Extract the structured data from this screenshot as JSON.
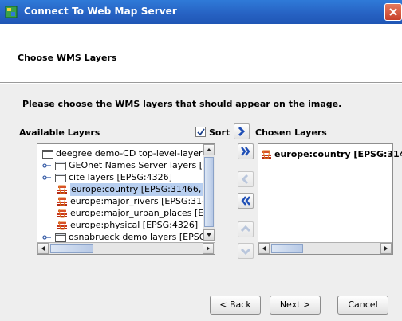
{
  "window": {
    "title": "Connect To Web Map Server",
    "close_icon": "close-icon"
  },
  "header": {
    "title": "Choose WMS Layers"
  },
  "main": {
    "instruction": "Please choose the WMS layers that should appear on the image.",
    "available_label": "Available Layers",
    "sort_label": "Sort",
    "sort_checked": true,
    "chosen_label": "Chosen Layers"
  },
  "available_layers": [
    {
      "text": "deegree demo-CD top-level-layer [E",
      "icon": "folder-icon",
      "level": 0,
      "expander": false
    },
    {
      "text": "GEOnet Names Server layers [E",
      "icon": "folder-icon",
      "level": 1,
      "expander": true
    },
    {
      "text": "cite layers [EPSG:4326]",
      "icon": "folder-icon",
      "level": 1,
      "expander": true
    },
    {
      "text": "europe:country [EPSG:31466, EP",
      "icon": "layer-icon",
      "level": 2,
      "selected": true
    },
    {
      "text": "europe:major_rivers [EPSG:3146",
      "icon": "layer-icon",
      "level": 2
    },
    {
      "text": "europe:major_urban_places [EP",
      "icon": "layer-icon",
      "level": 2
    },
    {
      "text": "europe:physical [EPSG:4326]",
      "icon": "layer-icon",
      "level": 2
    },
    {
      "text": "osnabrueck demo layers [EPSG",
      "icon": "folder-icon",
      "level": 1,
      "expander": true
    }
  ],
  "chosen_layers": [
    {
      "text": "europe:country [EPSG:314",
      "icon": "layer-icon"
    }
  ],
  "transfer_buttons": [
    {
      "name": "add-button",
      "icon": "chevron-right-icon",
      "enabled": true
    },
    {
      "name": "add-all-button",
      "icon": "double-chevron-right-icon",
      "enabled": true
    },
    {
      "name": "remove-button",
      "icon": "chevron-left-icon",
      "enabled": false
    },
    {
      "name": "remove-all-button",
      "icon": "double-chevron-left-icon",
      "enabled": true
    },
    {
      "name": "move-up-button",
      "icon": "chevron-up-icon",
      "enabled": false
    },
    {
      "name": "move-down-button",
      "icon": "chevron-down-icon",
      "enabled": false
    }
  ],
  "footer": {
    "back_label": "< Back",
    "next_label": "Next >",
    "cancel_label": "Cancel"
  },
  "colors": {
    "titlebar": "#2661c2",
    "arrow_blue": "#1f4fb6",
    "selection": "#b8cff0",
    "panel": "#eeeeee"
  }
}
